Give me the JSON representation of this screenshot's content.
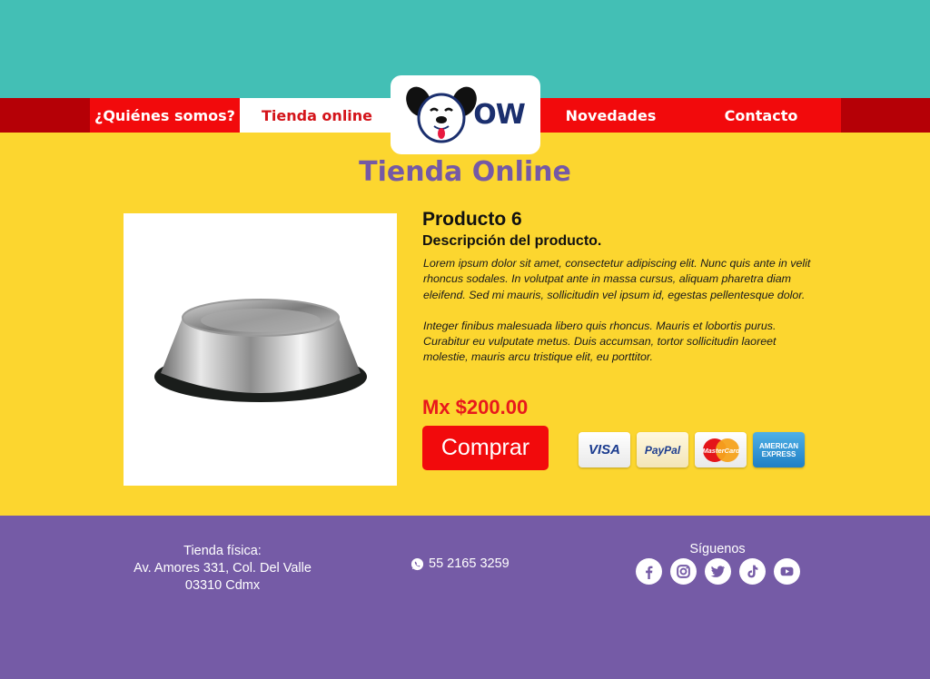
{
  "nav": {
    "about": "¿Quiénes somos?",
    "shop": "Tienda online",
    "news": "Novedades",
    "contact": "Contacto"
  },
  "logo": {
    "text": "OW"
  },
  "page": {
    "title": "Tienda Online"
  },
  "product": {
    "name": "Producto 6",
    "subtitle": "Descripción del producto.",
    "paragraph_1": "Lorem ipsum dolor sit amet, consectetur adipiscing elit. Nunc quis ante in velit rhoncus sodales. In volutpat ante in massa cursus, aliquam pharetra diam eleifend. Sed mi mauris, sollicitudin vel ipsum id, egestas pellentesque dolor.",
    "paragraph_2": "Integer finibus malesuada libero quis rhoncus. Mauris et lobortis purus. Curabitur eu vulputate metus. Duis accumsan, tortor sollicitudin laoreet molestie, mauris arcu tristique elit, eu porttitor.",
    "price": "Mx $200.00",
    "buy_label": "Comprar"
  },
  "payments": {
    "visa": "VISA",
    "paypal": "PayPal",
    "mastercard": "MasterCard",
    "amex_line1": "AMERICAN",
    "amex_line2": "EXPRESS"
  },
  "footer": {
    "store_label": "Tienda física:",
    "address_line1": "Av. Amores 331, Col. Del Valle",
    "address_line2": "03310 Cdmx",
    "phone": "55 2165 3259",
    "social_title": "Síguenos",
    "social_icons": [
      "facebook-icon",
      "instagram-icon",
      "twitter-icon",
      "tiktok-icon",
      "youtube-icon"
    ]
  },
  "colors": {
    "teal": "#43bfb5",
    "dark_red": "#b50006",
    "red": "#f20a0c",
    "yellow": "#fcd62f",
    "purple": "#755ba6"
  }
}
